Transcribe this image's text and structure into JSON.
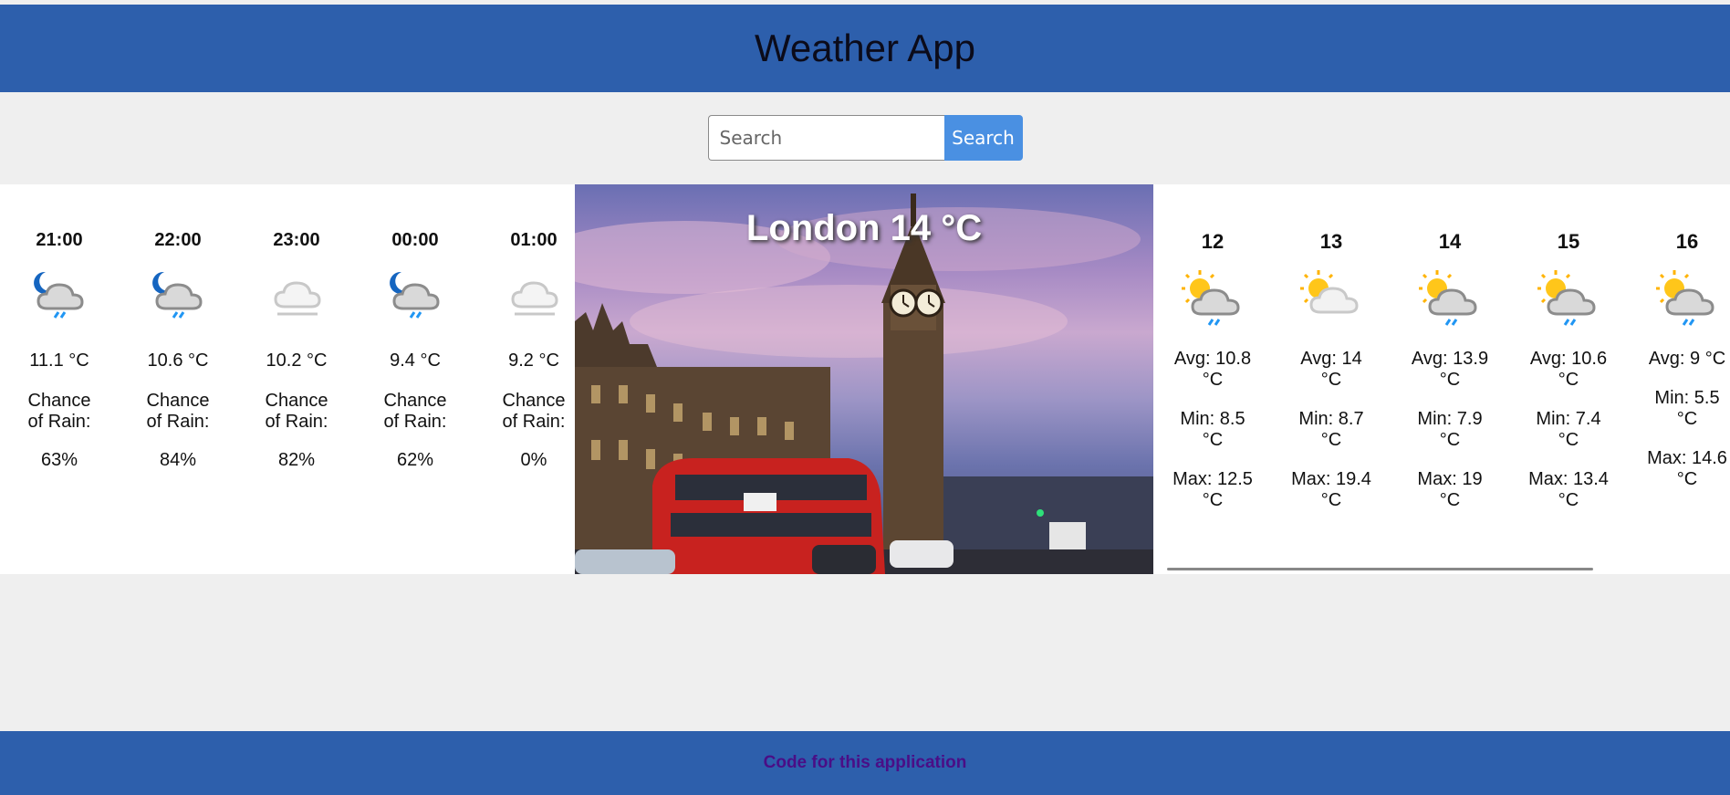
{
  "app": {
    "title": "Weather App"
  },
  "search": {
    "placeholder": "Search",
    "button_label": "Search"
  },
  "current": {
    "city_temp": "London 14 °C"
  },
  "hourly": [
    {
      "time": "21:00",
      "icon": "night-cloud-rain-icon",
      "temp": "11.1 °C",
      "rain_label": "Chance of Rain:",
      "rain": "63%"
    },
    {
      "time": "22:00",
      "icon": "night-cloud-rain-icon",
      "temp": "10.6 °C",
      "rain_label": "Chance of Rain:",
      "rain": "84%"
    },
    {
      "time": "23:00",
      "icon": "fog-icon",
      "temp": "10.2 °C",
      "rain_label": "Chance of Rain:",
      "rain": "82%"
    },
    {
      "time": "00:00",
      "icon": "night-cloud-rain-icon",
      "temp": "9.4 °C",
      "rain_label": "Chance of Rain:",
      "rain": "62%"
    },
    {
      "time": "01:00",
      "icon": "fog-icon",
      "temp": "9.2 °C",
      "rain_label": "Chance of Rain:",
      "rain": "0%"
    }
  ],
  "daily": [
    {
      "day": "12",
      "icon": "sun-cloud-rain-icon",
      "avg": "Avg: 10.8 °C",
      "min": "Min: 8.5 °C",
      "max": "Max: 12.5 °C"
    },
    {
      "day": "13",
      "icon": "sun-cloud-icon",
      "avg": "Avg: 14 °C",
      "min": "Min: 8.7 °C",
      "max": "Max: 19.4 °C"
    },
    {
      "day": "14",
      "icon": "sun-cloud-rain-icon",
      "avg": "Avg: 13.9 °C",
      "min": "Min: 7.9 °C",
      "max": "Max: 19 °C"
    },
    {
      "day": "15",
      "icon": "sun-cloud-rain-icon",
      "avg": "Avg: 10.6 °C",
      "min": "Min: 7.4 °C",
      "max": "Max: 13.4 °C"
    },
    {
      "day": "16",
      "icon": "sun-cloud-rain-icon",
      "avg": "Avg: 9 °C",
      "min": "Min: 5.5 °C",
      "max": "Max: 14.6 °C"
    }
  ],
  "footer": {
    "link_label": "Code for this application"
  },
  "colors": {
    "header": "#2d5fac",
    "search_button": "#4a90e2",
    "footer_link": "#4a0e86"
  }
}
